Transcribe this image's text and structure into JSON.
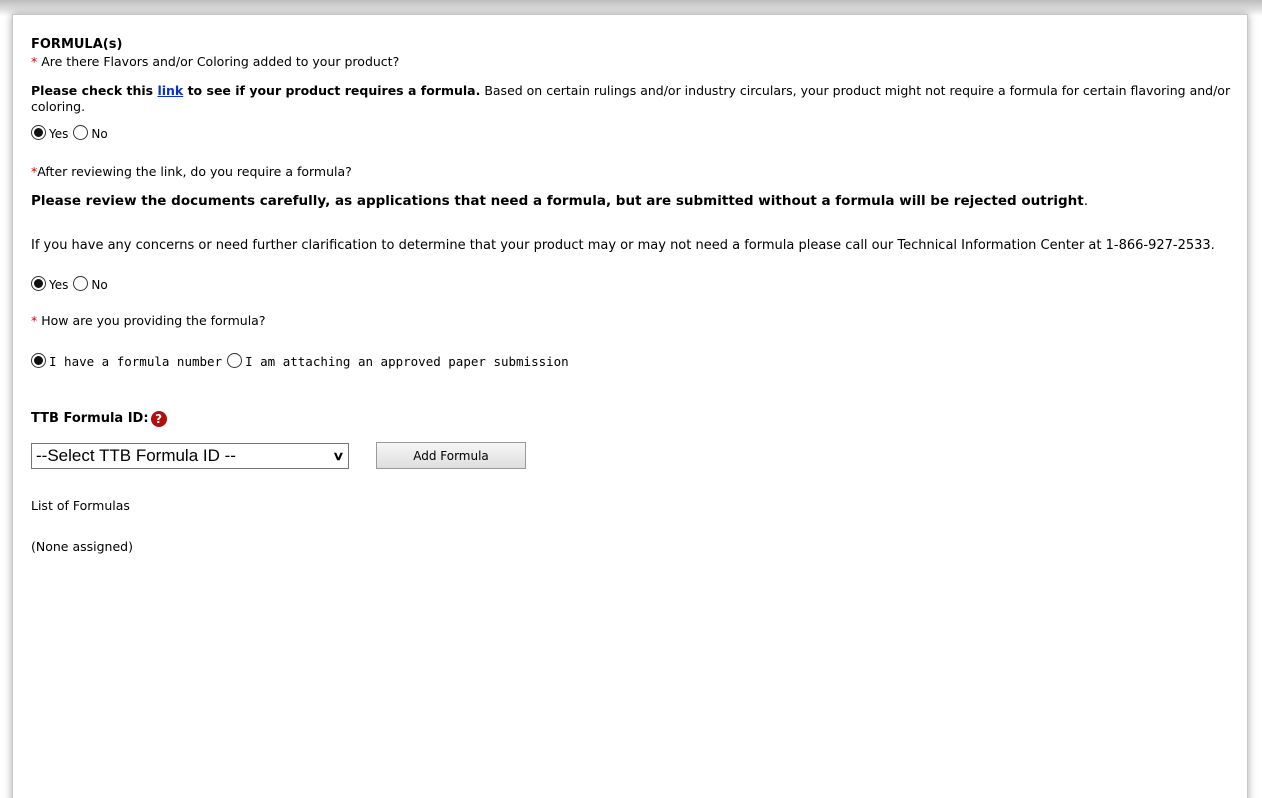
{
  "section_title": "FORMULA(s)",
  "required_marker": "*",
  "q1": {
    "question": " Are there Flavors and/or Coloring added to your product?",
    "bold_prefix": "Please check this ",
    "link_text": "link",
    "bold_suffix": " to see if your product requires a formula.",
    "note_text": " Based on certain rulings and/or industry circulars, your product might not require a formula for certain flavoring and/or coloring.",
    "options": {
      "yes": "Yes",
      "no": "No",
      "selected": "Yes"
    }
  },
  "q2": {
    "question": "After reviewing the link, do you require a formula?",
    "warning_bold": "Please review the documents carefully, as applications that need a formula, but are submitted without a formula will be rejected outright",
    "warning_period": ".",
    "contact_text": "If you have any concerns or need further clarification to determine that your product may or may not need a formula please call our Technical Information Center at 1-866-927-2533.",
    "options": {
      "yes": "Yes",
      "no": "No",
      "selected": "Yes"
    }
  },
  "q3": {
    "question": " How are you providing the formula?",
    "options": {
      "formula_number": "I have a formula number",
      "paper_submission": "I am attaching an approved paper submission",
      "selected": "I have a formula number"
    }
  },
  "formula_id": {
    "label": "TTB Formula ID:",
    "help_icon": "question-circle-icon",
    "select_value": "--Select TTB Formula ID --",
    "add_button": "Add Formula"
  },
  "formula_list": {
    "heading": "List of Formulas",
    "empty_text": "(None assigned)"
  },
  "colors": {
    "required": "#d00000",
    "link": "#0a2fd4",
    "help_icon": "#b30e0e"
  }
}
